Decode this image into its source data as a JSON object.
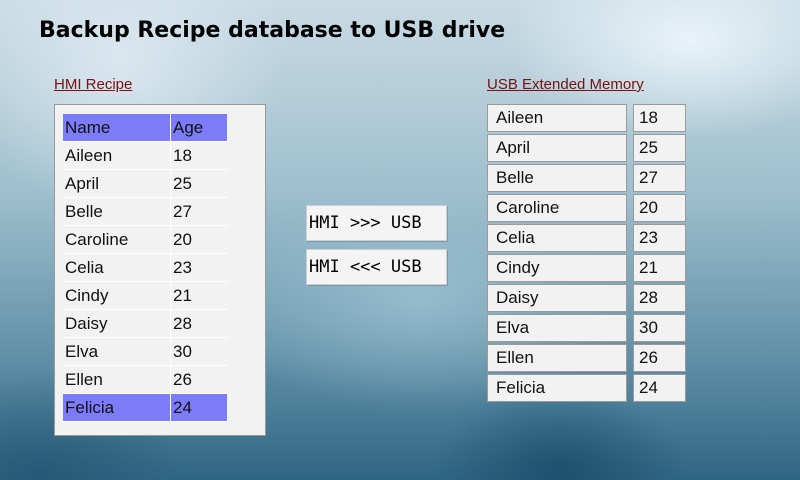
{
  "title": "Backup Recipe database to USB drive",
  "hmi": {
    "link_label": "HMI Recipe",
    "header": {
      "name": "Name",
      "age": "Age"
    },
    "rows": [
      {
        "name": "Aileen",
        "age": "18"
      },
      {
        "name": "April",
        "age": "25"
      },
      {
        "name": "Belle",
        "age": "27"
      },
      {
        "name": "Caroline",
        "age": "20"
      },
      {
        "name": "Celia",
        "age": "23"
      },
      {
        "name": "Cindy",
        "age": "21"
      },
      {
        "name": "Daisy",
        "age": "28"
      },
      {
        "name": "Elva",
        "age": "30"
      },
      {
        "name": "Ellen",
        "age": "26"
      },
      {
        "name": "Felicia",
        "age": "24"
      }
    ],
    "selected_name": "Felicia"
  },
  "buttons": {
    "to_usb": "HMI >>> USB",
    "to_hmi": "HMI <<< USB"
  },
  "usb": {
    "link_label": "USB Extended Memory",
    "rows": [
      {
        "name": "Aileen",
        "age": "18"
      },
      {
        "name": "April",
        "age": "25"
      },
      {
        "name": "Belle",
        "age": "27"
      },
      {
        "name": "Caroline",
        "age": "20"
      },
      {
        "name": "Celia",
        "age": "23"
      },
      {
        "name": "Cindy",
        "age": "21"
      },
      {
        "name": "Daisy",
        "age": "28"
      },
      {
        "name": "Elva",
        "age": "30"
      },
      {
        "name": "Ellen",
        "age": "26"
      },
      {
        "name": "Felicia",
        "age": "24"
      }
    ]
  },
  "colors": {
    "header_highlight": "#7c7cf8",
    "link": "#7a1010"
  }
}
